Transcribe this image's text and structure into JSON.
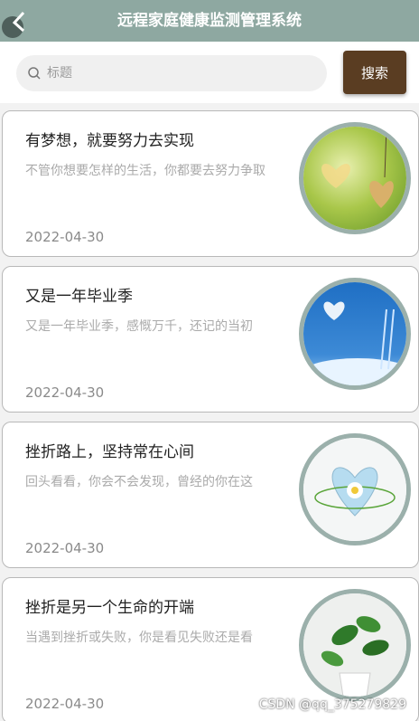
{
  "header": {
    "title": "远程家庭健康监测管理系统",
    "back_icon": "back-icon"
  },
  "search": {
    "placeholder": "标题",
    "value": "",
    "button_label": "搜索",
    "icon": "search-icon"
  },
  "articles": [
    {
      "title": "有梦想，就要努力去实现",
      "summary": "不管你想要怎样的生活，你都要去努力争取",
      "date": "2022-04-30",
      "image": "hearts-photo"
    },
    {
      "title": "又是一年毕业季",
      "summary": "又是一年毕业季，感慨万千，还记的当初",
      "date": "2022-04-30",
      "image": "sky-heart-photo"
    },
    {
      "title": "挫折路上，坚持常在心间",
      "summary": "回头看看，你会不会发现，曾经的你在这",
      "date": "2022-04-30",
      "image": "blue-heart-flower-photo"
    },
    {
      "title": "挫折是另一个生命的开端",
      "summary": "当遇到挫折或失败，你是看见失败还是看",
      "date": "2022-04-30",
      "image": "potted-plant-photo"
    }
  ],
  "watermark": "CSDN @qq_375279829",
  "colors": {
    "header": "#8ea8a1",
    "search_button": "#5a3d22",
    "thumb_border": "#9bb0ab"
  }
}
